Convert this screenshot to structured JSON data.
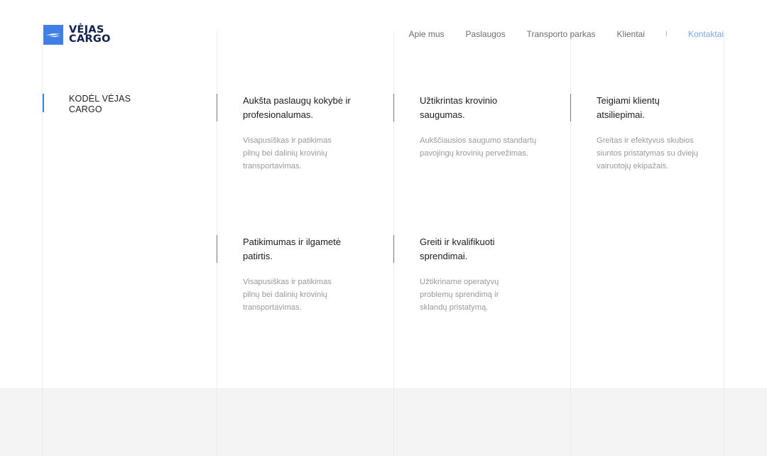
{
  "brand": {
    "logo_line1": "VĖJAS",
    "logo_line2": "CARGO",
    "accent_color": "#3f7fe6",
    "logo_color": "#0f1f52"
  },
  "nav": {
    "items": [
      "Apie mus",
      "Paslaugos",
      "Transporto parkas",
      "Klientai"
    ],
    "separator": "I",
    "active": "Kontaktai"
  },
  "section": {
    "title": "KODĖL VĖJAS CARGO"
  },
  "cards": [
    {
      "title": "Aukšta paslaugų kokybė ir profesionalumas.",
      "text": "Visapusiškas ir patikimas pilnų bei dalinių krovinių transportavimas."
    },
    {
      "title": "Užtikrintas krovinio saugumas.",
      "text": "Aukščiausios saugumo standartų pavojingų krovinių pervežimas."
    },
    {
      "title": "Teigiami klientų atsiliepimai.",
      "text": "Greitas ir efektyvus skubios siuntos pristatymas su dviejų vairuotojų ekipažais."
    },
    {
      "title": "Patikimumas ir ilgametė patirtis.",
      "text": "Visapusiškas ir patikimas pilnų bei dalinių krovinių transportavimas."
    },
    {
      "title": "Greiti ir kvalifikuoti sprendimai.",
      "text": "Užtikriname operatyvų problemų sprendimą ir sklandų pristatymą."
    }
  ]
}
